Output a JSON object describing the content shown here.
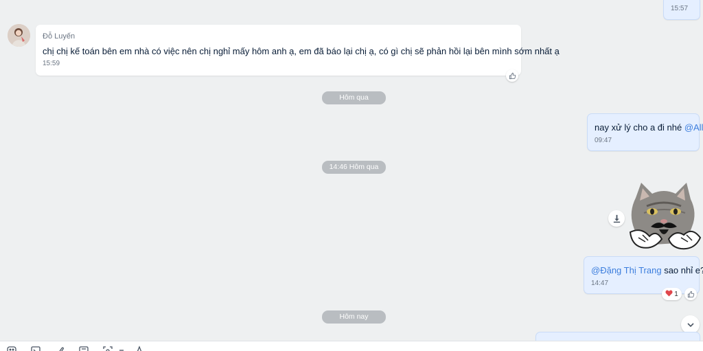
{
  "colors": {
    "background": "#eef0f1",
    "outgoing_bubble": "#e5efff",
    "incoming_bubble": "#ffffff",
    "mention": "#3b7ddd",
    "date_pill": "#b9bdc1"
  },
  "top_bubble": {
    "time": "15:57"
  },
  "incoming_message": {
    "sender": "Đỗ Luyến",
    "text": "chị chị kế toán bên em nhà có việc nên chị nghỉ mấy hôm anh ạ, em đã báo lại chị ạ, có gì chị sẽ phản hồi lại bên mình sớm nhất ạ",
    "time": "15:59",
    "reaction_icon": "thumbs-up-icon"
  },
  "date_separators": {
    "first": "Hôm qua",
    "second": "14:46 Hôm qua",
    "third": "Hôm nay"
  },
  "outgoing_message_1": {
    "text": "nay xử lý cho a đi nhé ",
    "mention": "@All",
    "time": "09:47"
  },
  "sticker": {
    "icon": "cat-mustache-sticker",
    "download_icon": "download-icon"
  },
  "outgoing_message_2": {
    "mention": "@Đặng Thị Trang",
    "text": " sao nhỉ e?",
    "time": "14:47",
    "reaction_emoji": "❤️",
    "reaction_count": "1"
  },
  "scroll_down_icon": "chevron-down-icon",
  "toolbar": {
    "icons": [
      "sticker-icon",
      "image-icon",
      "attachment-icon",
      "screenshot-icon",
      "capture-icon",
      "more-icon",
      "text-format-icon"
    ]
  }
}
